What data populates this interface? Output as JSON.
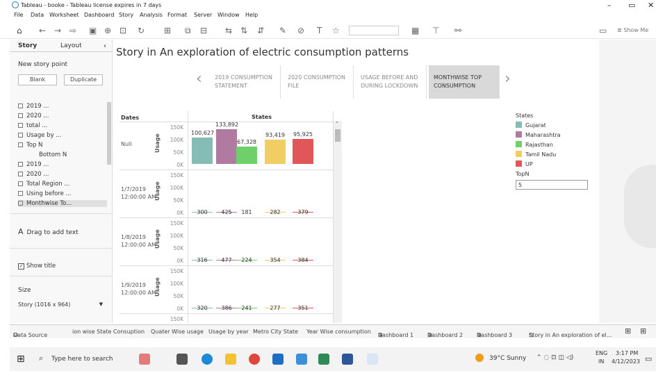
{
  "window": {
    "title": "Tableau - booke - Tableau license expires in 7 days"
  },
  "menu": [
    "File",
    "Data",
    "Worksheet",
    "Dashboard",
    "Story",
    "Analysis",
    "Format",
    "Server",
    "Window",
    "Help"
  ],
  "toolbar": {
    "show_me": "Show Me"
  },
  "sidebar": {
    "tab_story": "Story",
    "tab_layout": "Layout",
    "new_story_point": "New story point",
    "blank": "Blank",
    "duplicate": "Duplicate",
    "sheets": [
      "2019 ...",
      "2020 ...",
      "total ...",
      "Usage by ...",
      "Top N",
      "Bottom N",
      "2019 ...",
      "2020 ...",
      "Total Region ...",
      "Using before ...",
      "Monthwise To..."
    ],
    "drag_text": "Drag to add text",
    "show_title": "Show title",
    "size_label": "Size",
    "size_value": "Story (1016 x 964)"
  },
  "story": {
    "title": "Story in An exploration of electric consumption patterns",
    "points": [
      {
        "line1": "2019 CONSUMPTION",
        "line2": "STATEMENT"
      },
      {
        "line1": "2020 CONSUMPTION",
        "line2": "FILE"
      },
      {
        "line1": "USAGE BEFORE AND",
        "line2": "DURING LOCKDOWN"
      },
      {
        "line1": "MONTHWISE TOP",
        "line2": "CONSUMPTION"
      }
    ]
  },
  "viz": {
    "header_dates": "Dates",
    "header_states": "States",
    "axis_title": "Usage",
    "ticks": [
      "150K",
      "100K",
      "50K",
      "0K"
    ],
    "rows": [
      {
        "date": "Null",
        "time": "",
        "values": [
          "100,627",
          "133,892",
          "67,328",
          "93,419",
          "95,925"
        ]
      },
      {
        "date": "1/7/2019",
        "time": "12:00:00 AM",
        "values": [
          "300",
          "425",
          "181",
          "282",
          "379"
        ]
      },
      {
        "date": "1/8/2019",
        "time": "12:00:00 AM",
        "values": [
          "316",
          "477",
          "224",
          "354",
          "384"
        ]
      },
      {
        "date": "1/9/2019",
        "time": "12:00:00 AM",
        "values": [
          "320",
          "386",
          "241",
          "277",
          "351"
        ]
      }
    ],
    "extra_tick": "150K"
  },
  "legend": {
    "title": "States",
    "items": [
      {
        "name": "Gujarat",
        "color": "#86bcb6"
      },
      {
        "name": "Maharashtra",
        "color": "#b07aa1"
      },
      {
        "name": "Rajasthan",
        "color": "#6fcf6a"
      },
      {
        "name": "Tamil Nadu",
        "color": "#f1ce63"
      },
      {
        "name": "UP",
        "color": "#e15759"
      }
    ],
    "topn_label": "TopN",
    "topn_value": "5"
  },
  "chart_data": {
    "type": "bar",
    "categories": [
      "Gujarat",
      "Maharashtra",
      "Rajasthan",
      "Tamil Nadu",
      "UP"
    ],
    "series": [
      {
        "name": "Null",
        "values": [
          100627,
          133892,
          67328,
          93419,
          95925
        ]
      },
      {
        "name": "1/7/2019 12:00:00 AM",
        "values": [
          300,
          425,
          181,
          282,
          379
        ]
      },
      {
        "name": "1/8/2019 12:00:00 AM",
        "values": [
          316,
          477,
          224,
          354,
          384
        ]
      },
      {
        "name": "1/9/2019 12:00:00 AM",
        "values": [
          320,
          386,
          241,
          277,
          351
        ]
      }
    ],
    "ylabel": "Usage",
    "ylim": [
      0,
      150000
    ]
  },
  "sheet_tabs": [
    "Data Source",
    "ion wise State Consuption",
    "Quater Wise usage",
    "Usage by year",
    "Metro City State",
    "Year Wise consumption",
    "Dashboard 1",
    "Dashboard 2",
    "Dashboard 3",
    "Story in An exploration of el..."
  ],
  "taskbar": {
    "search_placeholder": "Type here to search",
    "weather": "39°C  Sunny",
    "lang1": "ENG",
    "lang2": "IN",
    "time": "3:17 PM",
    "date": "4/12/2023"
  }
}
